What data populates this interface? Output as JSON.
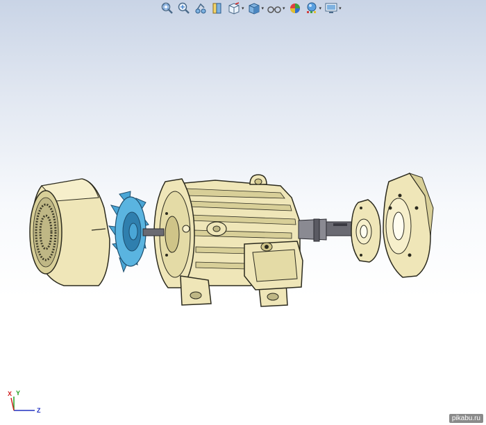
{
  "toolbar": {
    "items": [
      {
        "name": "zoom-to-fit",
        "icon": "zoom-to-fit-icon",
        "has_dropdown": false
      },
      {
        "name": "zoom-to-area",
        "icon": "zoom-to-area-icon",
        "has_dropdown": false
      },
      {
        "name": "previous-view",
        "icon": "previous-view-icon",
        "has_dropdown": false
      },
      {
        "name": "section-view",
        "icon": "section-view-icon",
        "has_dropdown": false
      },
      {
        "name": "view-orientation",
        "icon": "view-orientation-icon",
        "has_dropdown": true
      },
      {
        "name": "display-style",
        "icon": "display-style-icon",
        "has_dropdown": true
      },
      {
        "name": "hide-show-items",
        "icon": "hide-show-items-icon",
        "has_dropdown": true
      },
      {
        "name": "edit-appearance",
        "icon": "edit-appearance-icon",
        "has_dropdown": false
      },
      {
        "name": "apply-scene",
        "icon": "apply-scene-icon",
        "has_dropdown": true
      },
      {
        "name": "view-settings",
        "icon": "view-settings-icon",
        "has_dropdown": true
      }
    ]
  },
  "model": {
    "parts": [
      "fan-cover",
      "cooling-fan",
      "motor-housing",
      "terminal-box",
      "shaft",
      "small-flange",
      "large-flange"
    ],
    "colors": {
      "body": "#efe6b8",
      "body_shade": "#cfc488",
      "outline": "#2b2a1e",
      "fan": "#4aa6d6",
      "fan_dark": "#2f7fae",
      "shaft": "#6a6a72"
    }
  },
  "triad": {
    "x": "X",
    "y": "Y",
    "z": "Z",
    "x_color": "#d02020",
    "y_color": "#20a020",
    "z_color": "#2030c0"
  },
  "watermark": {
    "text": "pikabu.ru"
  }
}
